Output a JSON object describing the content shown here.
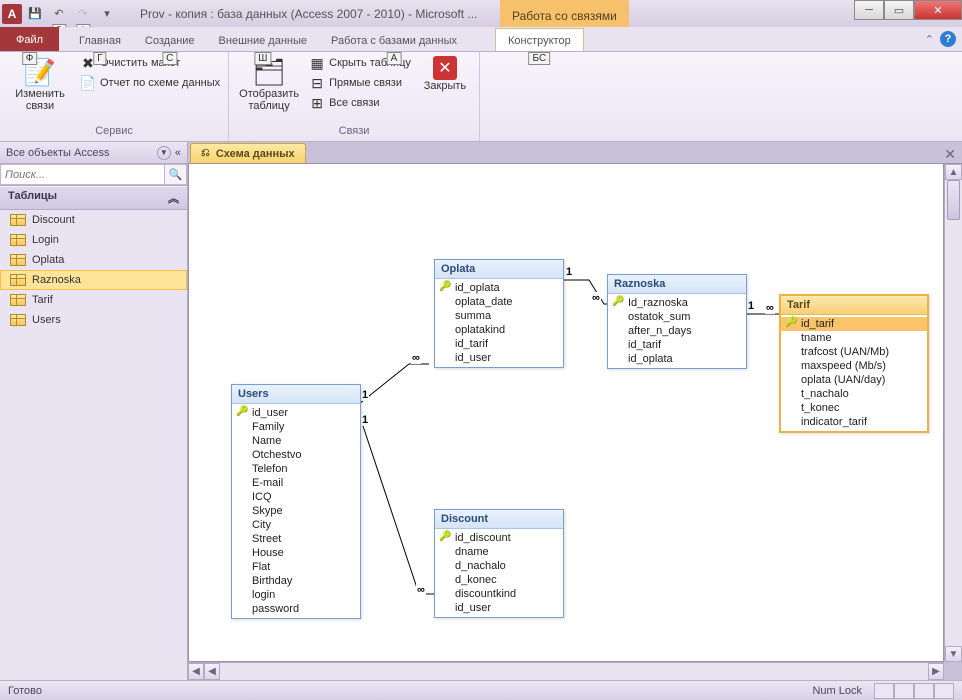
{
  "title": "Prov - копия : база данных (Access 2007 - 2010)  -  Microsoft ...",
  "context_group": "Работа со связями",
  "qat_keytips": [
    "1",
    "2",
    "3"
  ],
  "tabs": {
    "file": "Файл",
    "home": "Главная",
    "create": "Создание",
    "external": "Внешние данные",
    "dbtools": "Работа с базами данных",
    "design": "Конструктор"
  },
  "keytips": {
    "file": "Ф",
    "home": "Г",
    "create": "С",
    "external": "Ш",
    "dbtools": "А",
    "design": "БС"
  },
  "ribbon": {
    "edit_rel": "Изменить связи",
    "clear_layout": "Очистить макет",
    "rel_report": "Отчет по схеме данных",
    "group_service": "Сервис",
    "show_table": "Отобразить таблицу",
    "hide_table": "Скрыть таблицу",
    "direct_rel": "Прямые связи",
    "all_rel": "Все связи",
    "group_rel": "Связи",
    "close": "Закрыть"
  },
  "nav": {
    "header": "Все объекты Access",
    "search_placeholder": "Поиск...",
    "group": "Таблицы",
    "items": [
      "Discount",
      "Login",
      "Oplata",
      "Raznoska",
      "Tarif",
      "Users"
    ]
  },
  "doc_tab": "Схема данных",
  "tables": {
    "users": {
      "title": "Users",
      "fields": [
        "id_user",
        "Family",
        "Name",
        "Otchestvo",
        "Telefon",
        "E-mail",
        "ICQ",
        "Skype",
        "City",
        "Street",
        "House",
        "Flat",
        "Birthday",
        "login",
        "password"
      ],
      "pk": [
        0
      ]
    },
    "oplata": {
      "title": "Oplata",
      "fields": [
        "id_oplata",
        "oplata_date",
        "summa",
        "oplatakind",
        "id_tarif",
        "id_user"
      ],
      "pk": [
        0
      ]
    },
    "discount": {
      "title": "Discount",
      "fields": [
        "id_discount",
        "dname",
        "d_nachalo",
        "d_konec",
        "discountkind",
        "id_user"
      ],
      "pk": [
        0
      ]
    },
    "raznoska": {
      "title": "Raznoska",
      "fields": [
        "Id_raznoska",
        "ostatok_sum",
        "after_n_days",
        "id_tarif",
        "id_oplata"
      ],
      "pk": [
        0
      ]
    },
    "tarif": {
      "title": "Tarif",
      "fields": [
        "id_tarif",
        "tname",
        "trafcost (UAN/Mb)",
        "maxspeed (Mb/s)",
        "oplata (UAN/day)",
        "t_nachalo",
        "t_konec",
        "indicator_tarif"
      ],
      "pk": [
        0
      ],
      "sel_field": 0
    }
  },
  "status": {
    "ready": "Готово",
    "numlock": "Num Lock"
  }
}
